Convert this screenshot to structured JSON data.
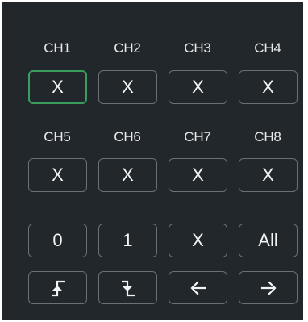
{
  "channels_row1": [
    {
      "label": "CH1",
      "value": "X",
      "selected": true
    },
    {
      "label": "CH2",
      "value": "X",
      "selected": false
    },
    {
      "label": "CH3",
      "value": "X",
      "selected": false
    },
    {
      "label": "CH4",
      "value": "X",
      "selected": false
    }
  ],
  "channels_row2": [
    {
      "label": "CH5",
      "value": "X",
      "selected": false
    },
    {
      "label": "CH6",
      "value": "X",
      "selected": false
    },
    {
      "label": "CH7",
      "value": "X",
      "selected": false
    },
    {
      "label": "CH8",
      "value": "X",
      "selected": false
    }
  ],
  "keypad": {
    "zero": "0",
    "one": "1",
    "x": "X",
    "all": "All"
  },
  "icons": {
    "rising_edge": "rising-edge-icon",
    "falling_edge": "falling-edge-icon",
    "left": "arrow-left-icon",
    "right": "arrow-right-icon"
  },
  "colors": {
    "background": "#22272b",
    "border": "#6a7075",
    "selected_border": "#3a9d5d",
    "text": "#f2f3f4"
  }
}
